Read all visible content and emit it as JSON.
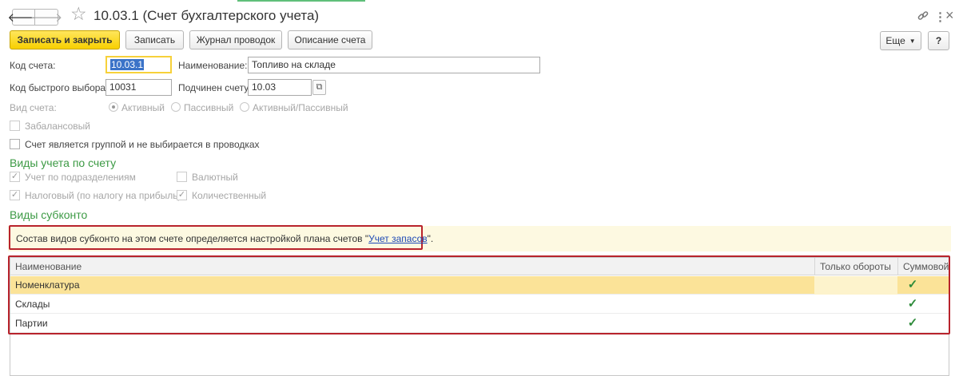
{
  "window": {
    "title": "10.03.1 (Счет бухгалтерского учета)",
    "back_label": "🡐",
    "forward_label": "🡒",
    "link_icon": "link-icon",
    "menu_icon": "⋮",
    "close_icon": "×"
  },
  "toolbar": {
    "save_close_label": "Записать и закрыть",
    "save_label": "Записать",
    "journal_label": "Журнал проводок",
    "description_label": "Описание счета",
    "more_label": "Еще",
    "help_label": "?"
  },
  "form": {
    "code_label": "Код счета:",
    "code_value": "10.03.1",
    "name_label": "Наименование:",
    "name_value": "Топливо на складе",
    "quick_code_label": "Код быстрого выбора:",
    "quick_code_value": "10031",
    "parent_label": "Подчинен счету:",
    "parent_value": "10.03",
    "kind_label": "Вид счета:",
    "kind_options": [
      "Активный",
      "Пассивный",
      "Активный/Пассивный"
    ],
    "kind_selected": "Активный",
    "offbalance_label": "Забалансовый",
    "offbalance_checked": false,
    "group_label": "Счет является группой и не выбирается в проводках",
    "group_checked": false
  },
  "accounting_types": {
    "heading": "Виды учета по счету",
    "by_departments_label": "Учет по подразделениям",
    "by_departments_checked": true,
    "currency_label": "Валютный",
    "currency_checked": false,
    "tax_label": "Налоговый (по налогу на прибыль)",
    "tax_checked": true,
    "quantity_label": "Количественный",
    "quantity_checked": true
  },
  "subconto": {
    "heading": "Виды субконто",
    "info_prefix": "Состав видов субконто на этом счете определяется настройкой плана счетов \"",
    "info_link": "Учет запасов",
    "info_suffix": "\".",
    "columns": [
      "Наименование",
      "Только обороты",
      "Суммовой"
    ],
    "rows": [
      {
        "name": "Номенклатура",
        "turnover_only": false,
        "sum": true
      },
      {
        "name": "Склады",
        "turnover_only": false,
        "sum": true
      },
      {
        "name": "Партии",
        "turnover_only": false,
        "sum": true
      }
    ],
    "check_mark": "✓"
  },
  "colors": {
    "primary_button": "#f8d000",
    "section_heading": "#3c9a44",
    "highlight_box": "#b8232c",
    "selected_row": "#fbe398",
    "info_background": "#fdf9e1"
  }
}
